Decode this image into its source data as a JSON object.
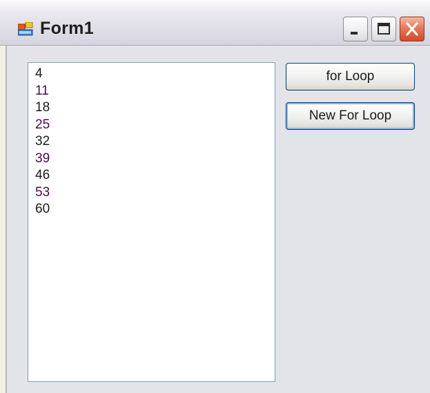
{
  "window": {
    "title": "Form1",
    "icon": "form-app-icon"
  },
  "titlebar_buttons": {
    "minimize_icon": "minimize-icon",
    "maximize_icon": "maximize-icon",
    "close_icon": "close-icon"
  },
  "listbox": {
    "items": [
      "4",
      "11",
      "18",
      "25",
      "32",
      "39",
      "46",
      "53",
      "60"
    ]
  },
  "buttons": {
    "for_loop_label": "for Loop",
    "new_for_loop_label": "New For Loop"
  },
  "colors": {
    "close_button": "#d04b2a",
    "focus_ring": "#8fb4e8",
    "button_border": "#003c74",
    "listbox_border": "#7f9db9"
  }
}
